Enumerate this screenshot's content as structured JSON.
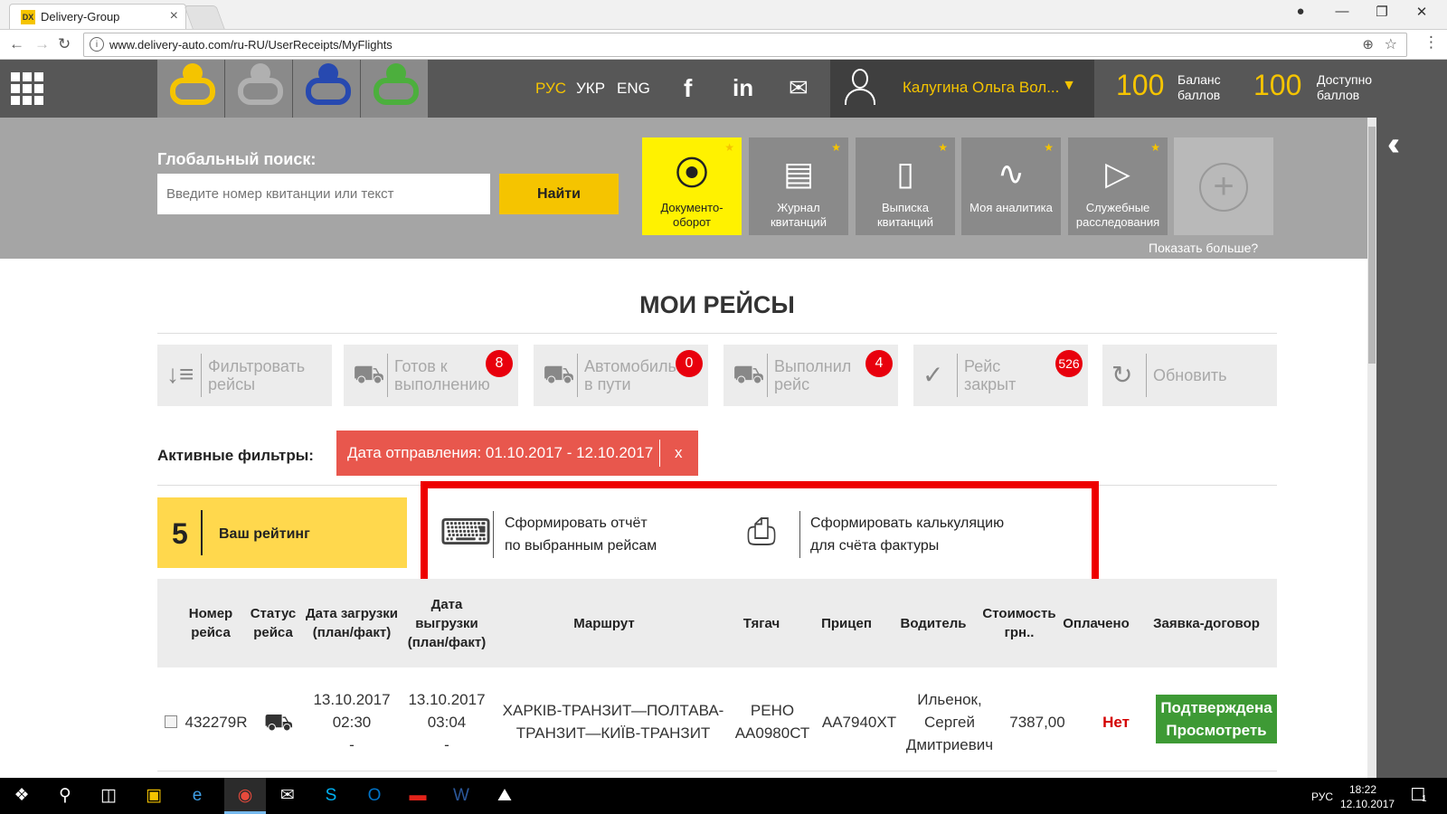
{
  "browser": {
    "tab_title": "Delivery-Group",
    "favicon_text": "DX",
    "url": "www.delivery-auto.com/ru-RU/UserReceipts/MyFlights",
    "close_glyph": "×"
  },
  "header": {
    "langs": [
      "РУС",
      "УКР",
      "ENG"
    ],
    "user_name": "Калугина Ольга Вол...",
    "balance_value": "100",
    "balance_label": "Баланс баллов",
    "available_value": "100",
    "available_label": "Доступно баллов"
  },
  "search": {
    "label": "Глобальный поиск:",
    "placeholder": "Введите номер квитанции или текст",
    "button": "Найти"
  },
  "tiles": [
    {
      "label": "Документо-оборот",
      "icon": "document-flow-icon"
    },
    {
      "label": "Журнал квитанций",
      "icon": "receipt-journal-icon"
    },
    {
      "label": "Выписка квитанций",
      "icon": "receipt-issue-icon"
    },
    {
      "label": "Моя аналитика",
      "icon": "analytics-icon"
    },
    {
      "label": "Служебные расследования",
      "icon": "investigation-icon"
    }
  ],
  "show_more": "Показать больше?",
  "page_title": "МОИ РЕЙСЫ",
  "filters": [
    {
      "label": "Фильтровать рейсы",
      "count": null,
      "icon": "filter-icon"
    },
    {
      "label": "Готов к выполнению",
      "count": "8",
      "icon": "truck-ready-icon"
    },
    {
      "label": "Автомобиль в пути",
      "count": "0",
      "icon": "truck-moving-icon"
    },
    {
      "label": "Выполнил рейс",
      "count": "4",
      "icon": "truck-done-icon"
    },
    {
      "label": "Рейс закрыт",
      "count": "526",
      "icon": "check-circle-icon"
    },
    {
      "label": "Обновить",
      "count": null,
      "icon": "refresh-icon"
    }
  ],
  "active_filters": {
    "label": "Активные фильтры:",
    "chip": "Дата отправления: 01.10.2017 - 12.10.2017",
    "remove": "x"
  },
  "rating": {
    "value": "5",
    "label": "Ваш рейтинг"
  },
  "actions": [
    {
      "label_line1": "Сформировать отчёт",
      "label_line2": "по выбранным рейсам",
      "icon": "report-icon"
    },
    {
      "label_line1": "Сформировать калькуляцию",
      "label_line2": "для счёта фактуры",
      "icon": "printer-icon"
    }
  ],
  "table": {
    "headers": [
      "Номер рейса",
      "Статус рейса",
      "Дата загрузки (план/факт)",
      "Дата выгрузки (план/факт)",
      "Маршрут",
      "Тягач",
      "Прицеп",
      "Водитель",
      "Стоимость грн..",
      "Оплачено",
      "Заявка-договор"
    ],
    "rows": [
      {
        "number": "432279R",
        "status_icon": "truck-ready-icon",
        "load_date": "13.10.2017",
        "load_time": "02:30",
        "load_fact": "-",
        "unload_date": "13.10.2017",
        "unload_time": "03:04",
        "unload_fact": "-",
        "route": "ХАРКІВ-ТРАНЗИТ—ПОЛТАВА-ТРАНЗИТ—КИЇВ-ТРАНЗИТ",
        "tractor_brand": "РЕНО",
        "tractor_plate": "АА0980СТ",
        "trailer": "АА7940ХТ",
        "driver": "Ильенок, Сергей Дмитриевич",
        "cost": "7387,00",
        "paid": "Нет",
        "contract_status": "Подтверждена",
        "contract_view": "Просмотреть"
      }
    ]
  },
  "taskbar": {
    "lang": "РУС",
    "time": "18:22",
    "date": "12.10.2017",
    "notif_count": "1"
  },
  "colors": {
    "accent_yellow": "#f5c400",
    "header_gray": "#575757",
    "panel_gray": "#a5a5a5",
    "badge_red": "#e8000d",
    "chip_red": "#e8574d",
    "highlight_red": "#ee0000",
    "confirm_green": "#3e9a35",
    "paid_no_red": "#d40000"
  }
}
